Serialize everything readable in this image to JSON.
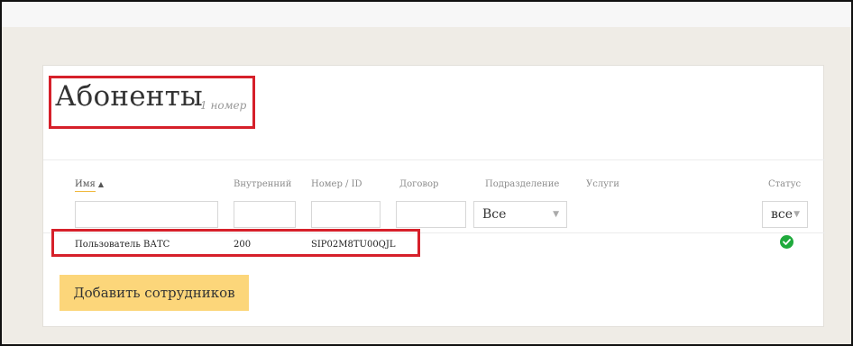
{
  "header": {
    "title": "Абоненты",
    "count": "1 номер"
  },
  "table": {
    "columns": {
      "name": "Имя",
      "internal": "Внутренний",
      "number": "Номер / ID",
      "contract": "Договор",
      "department": "Подразделение",
      "services": "Услуги",
      "status": "Статус"
    },
    "filters": {
      "department_value": "Все",
      "status_value": "все"
    },
    "rows": [
      {
        "name": "Пользователь ВАТС",
        "internal": "200",
        "number": "SIP02M8TU00QJL",
        "status_icon": "check-circle-icon"
      }
    ]
  },
  "actions": {
    "add_label": "Добавить сотрудников"
  },
  "colors": {
    "accent": "#fcd67a",
    "highlight": "#d6202a",
    "status_ok": "#1faa3c"
  }
}
